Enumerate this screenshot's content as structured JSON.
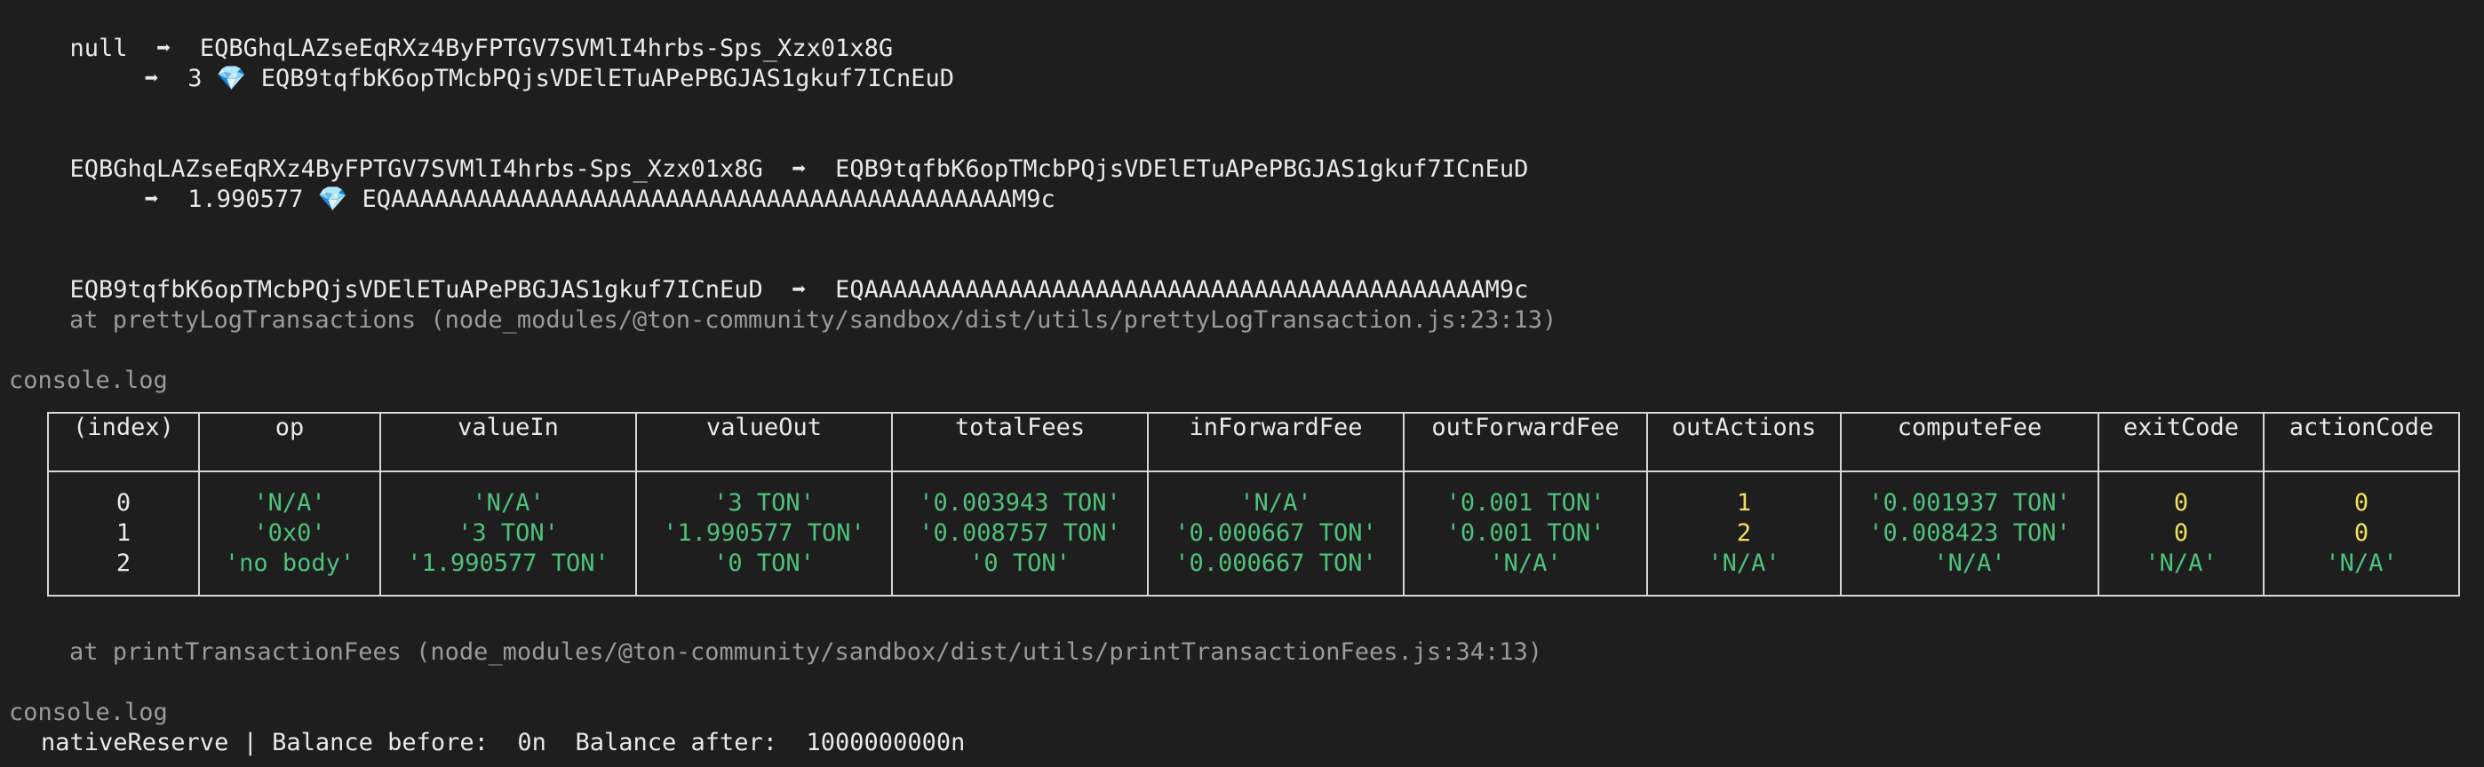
{
  "log_lines": {
    "l1": {
      "from": "null",
      "to": "EQBGhqLAZseEqRXz4ByFPTGV7SVMlI4hrbs-Sps_Xzx01x8G"
    },
    "l2": {
      "amount": "3",
      "address": "EQB9tqfbK6opTMcbPQjsVDElETuAPePBGJAS1gkuf7ICnEuD"
    },
    "l3": {
      "from": "EQBGhqLAZseEqRXz4ByFPTGV7SVMlI4hrbs-Sps_Xzx01x8G",
      "to": "EQB9tqfbK6opTMcbPQjsVDElETuAPePBGJAS1gkuf7ICnEuD"
    },
    "l4": {
      "amount": "1.990577",
      "address": "EQAAAAAAAAAAAAAAAAAAAAAAAAAAAAAAAAAAAAAAAAAAAM9c"
    },
    "l5": {
      "from": "EQB9tqfbK6opTMcbPQjsVDElETuAPePBGJAS1gkuf7ICnEuD",
      "to": "EQAAAAAAAAAAAAAAAAAAAAAAAAAAAAAAAAAAAAAAAAAAAM9c"
    },
    "arrow_glyph": "➡",
    "gem_glyph": "💎"
  },
  "stack1": "at prettyLogTransactions (node_modules/@ton-community/sandbox/dist/utils/prettyLogTransaction.js:23:13)",
  "console_label": "console.log",
  "table": {
    "headers": [
      "(index)",
      "op",
      "valueIn",
      "valueOut",
      "totalFees",
      "inForwardFee",
      "outForwardFee",
      "outActions",
      "computeFee",
      "exitCode",
      "actionCode"
    ],
    "rows": [
      [
        "0",
        "'N/A'",
        "'N/A'",
        "'3 TON'",
        "'0.003943 TON'",
        "'N/A'",
        "'0.001 TON'",
        "1",
        "'0.001937 TON'",
        "0",
        "0"
      ],
      [
        "1",
        "'0x0'",
        "'3 TON'",
        "'1.990577 TON'",
        "'0.008757 TON'",
        "'0.000667 TON'",
        "'0.001 TON'",
        "2",
        "'0.008423 TON'",
        "0",
        "0"
      ],
      [
        "2",
        "'no body'",
        "'1.990577 TON'",
        "'0 TON'",
        "'0 TON'",
        "'0.000667 TON'",
        "'N/A'",
        "'N/A'",
        "'N/A'",
        "'N/A'",
        "'N/A'"
      ]
    ]
  },
  "stack2": "at printTransactionFees (node_modules/@ton-community/sandbox/dist/utils/printTransactionFees.js:34:13)",
  "console_label2": "console.log",
  "reserve_line": "nativeReserve | Balance before:  0n  Balance after:  1000000000n",
  "colors": {
    "background": "#1e1e1e",
    "string": "#4ec27a",
    "number": "#f2e05b",
    "dim": "#9a9a9a"
  }
}
